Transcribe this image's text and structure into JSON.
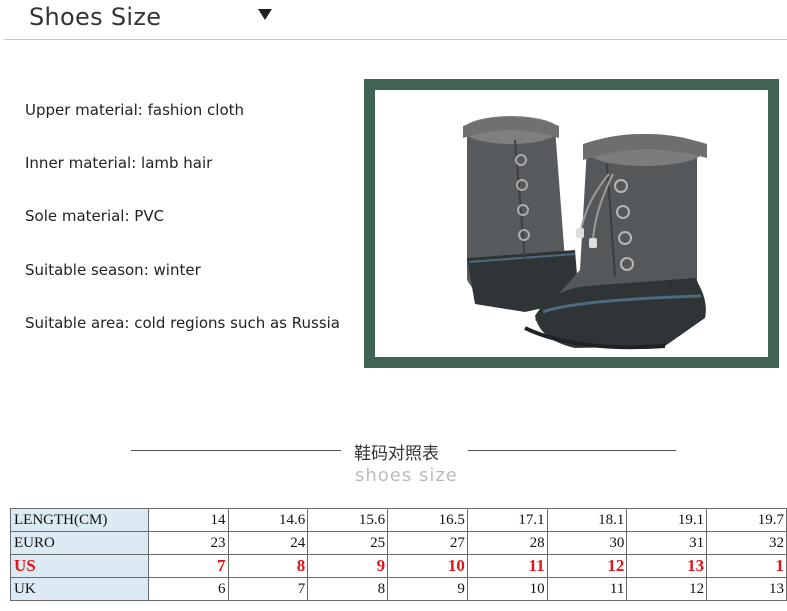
{
  "header": {
    "title": "Shoes Size"
  },
  "specs": [
    "Upper material: fashion cloth",
    "Inner material: lamb hair",
    "Sole material: PVC",
    "Suitable season: winter",
    "Suitable area: cold regions such as Russia"
  ],
  "section": {
    "title_cn": "鞋码对照表",
    "title_en": "shoes  size"
  },
  "size_table": {
    "rows": [
      {
        "label": "LENGTH(CM)",
        "values": [
          "14",
          "14.6",
          "15.6",
          "16.5",
          "17.1",
          "18.1",
          "19.1",
          "19.7"
        ]
      },
      {
        "label": "EURO",
        "values": [
          "23",
          "24",
          "25",
          "27",
          "28",
          "30",
          "31",
          "32"
        ]
      },
      {
        "label": "US",
        "values": [
          "7",
          "8",
          "9",
          "10",
          "11",
          "12",
          "13",
          "1"
        ]
      },
      {
        "label": "UK",
        "values": [
          "6",
          "7",
          "8",
          "9",
          "10",
          "11",
          "12",
          "13"
        ]
      }
    ]
  },
  "colors": {
    "frame": "#3f6452",
    "table_label_bg": "#dcebf3",
    "us_row_text": "#e0131a",
    "boot_body": "#55585b",
    "boot_fur": "#7a7c7d",
    "boot_sole": "#2f3436"
  }
}
